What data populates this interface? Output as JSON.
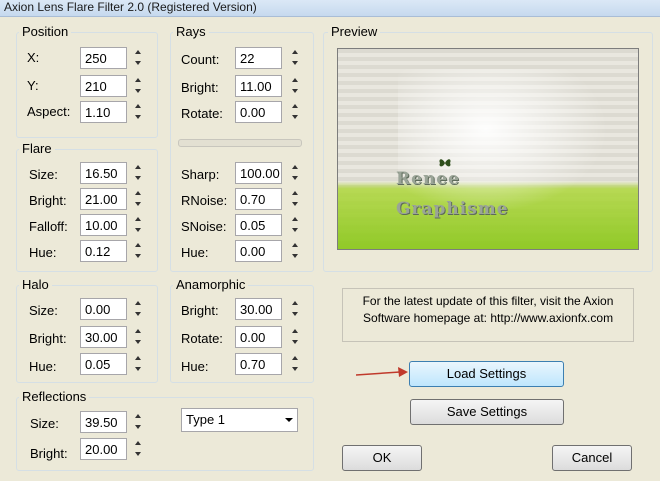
{
  "window": {
    "title": "Axion Lens Flare Filter 2.0 (Registered Version)"
  },
  "position": {
    "title": "Position",
    "fields": [
      {
        "label": "X:",
        "value": "250"
      },
      {
        "label": "Y:",
        "value": "210"
      },
      {
        "label": "Aspect:",
        "value": "1.10"
      }
    ]
  },
  "rays": {
    "title": "Rays",
    "fields": [
      {
        "label": "Count:",
        "value": "22"
      },
      {
        "label": "Bright:",
        "value": "11.00"
      },
      {
        "label": "Rotate:",
        "value": "0.00"
      },
      {
        "label": "Sharp:",
        "value": "100.00"
      },
      {
        "label": "RNoise:",
        "value": "0.70"
      },
      {
        "label": "SNoise:",
        "value": "0.05"
      },
      {
        "label": "Hue:",
        "value": "0.00"
      }
    ]
  },
  "flare": {
    "title": "Flare",
    "fields": [
      {
        "label": "Size:",
        "value": "16.50"
      },
      {
        "label": "Bright:",
        "value": "21.00"
      },
      {
        "label": "Falloff:",
        "value": "10.00"
      },
      {
        "label": "Hue:",
        "value": "0.12"
      }
    ]
  },
  "halo": {
    "title": "Halo",
    "fields": [
      {
        "label": "Size:",
        "value": "0.00"
      },
      {
        "label": "Bright:",
        "value": "30.00"
      },
      {
        "label": "Hue:",
        "value": "0.05"
      }
    ]
  },
  "anamorphic": {
    "title": "Anamorphic",
    "fields": [
      {
        "label": "Bright:",
        "value": "30.00"
      },
      {
        "label": "Rotate:",
        "value": "0.00"
      },
      {
        "label": "Hue:",
        "value": "0.70"
      }
    ]
  },
  "reflections": {
    "title": "Reflections",
    "fields": [
      {
        "label": "Size:",
        "value": "39.50"
      },
      {
        "label": "Bright:",
        "value": "20.00"
      }
    ],
    "type_value": "Type 1"
  },
  "preview": {
    "title": "Preview",
    "watermark_line1": "Renee",
    "watermark_line2": "Graphisme"
  },
  "info": {
    "line1": "For the latest update of this filter, visit the Axion",
    "line2": "Software homepage at: http://www.axionfx.com"
  },
  "buttons": {
    "load": "Load Settings",
    "save": "Save Settings",
    "ok": "OK",
    "cancel": "Cancel"
  },
  "colors": {
    "annotation_arrow": "#c0392b",
    "preview_green": "#a4d63c"
  }
}
